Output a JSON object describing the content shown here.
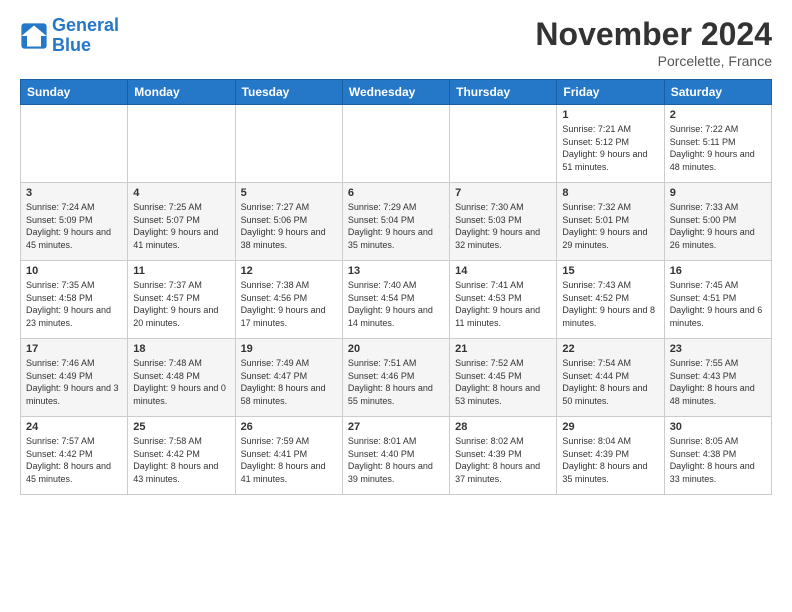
{
  "logo": {
    "line1": "General",
    "line2": "Blue"
  },
  "title": "November 2024",
  "location": "Porcelette, France",
  "days_header": [
    "Sunday",
    "Monday",
    "Tuesday",
    "Wednesday",
    "Thursday",
    "Friday",
    "Saturday"
  ],
  "weeks": [
    [
      {
        "day": "",
        "info": ""
      },
      {
        "day": "",
        "info": ""
      },
      {
        "day": "",
        "info": ""
      },
      {
        "day": "",
        "info": ""
      },
      {
        "day": "",
        "info": ""
      },
      {
        "day": "1",
        "info": "Sunrise: 7:21 AM\nSunset: 5:12 PM\nDaylight: 9 hours and 51 minutes."
      },
      {
        "day": "2",
        "info": "Sunrise: 7:22 AM\nSunset: 5:11 PM\nDaylight: 9 hours and 48 minutes."
      }
    ],
    [
      {
        "day": "3",
        "info": "Sunrise: 7:24 AM\nSunset: 5:09 PM\nDaylight: 9 hours and 45 minutes."
      },
      {
        "day": "4",
        "info": "Sunrise: 7:25 AM\nSunset: 5:07 PM\nDaylight: 9 hours and 41 minutes."
      },
      {
        "day": "5",
        "info": "Sunrise: 7:27 AM\nSunset: 5:06 PM\nDaylight: 9 hours and 38 minutes."
      },
      {
        "day": "6",
        "info": "Sunrise: 7:29 AM\nSunset: 5:04 PM\nDaylight: 9 hours and 35 minutes."
      },
      {
        "day": "7",
        "info": "Sunrise: 7:30 AM\nSunset: 5:03 PM\nDaylight: 9 hours and 32 minutes."
      },
      {
        "day": "8",
        "info": "Sunrise: 7:32 AM\nSunset: 5:01 PM\nDaylight: 9 hours and 29 minutes."
      },
      {
        "day": "9",
        "info": "Sunrise: 7:33 AM\nSunset: 5:00 PM\nDaylight: 9 hours and 26 minutes."
      }
    ],
    [
      {
        "day": "10",
        "info": "Sunrise: 7:35 AM\nSunset: 4:58 PM\nDaylight: 9 hours and 23 minutes."
      },
      {
        "day": "11",
        "info": "Sunrise: 7:37 AM\nSunset: 4:57 PM\nDaylight: 9 hours and 20 minutes."
      },
      {
        "day": "12",
        "info": "Sunrise: 7:38 AM\nSunset: 4:56 PM\nDaylight: 9 hours and 17 minutes."
      },
      {
        "day": "13",
        "info": "Sunrise: 7:40 AM\nSunset: 4:54 PM\nDaylight: 9 hours and 14 minutes."
      },
      {
        "day": "14",
        "info": "Sunrise: 7:41 AM\nSunset: 4:53 PM\nDaylight: 9 hours and 11 minutes."
      },
      {
        "day": "15",
        "info": "Sunrise: 7:43 AM\nSunset: 4:52 PM\nDaylight: 9 hours and 8 minutes."
      },
      {
        "day": "16",
        "info": "Sunrise: 7:45 AM\nSunset: 4:51 PM\nDaylight: 9 hours and 6 minutes."
      }
    ],
    [
      {
        "day": "17",
        "info": "Sunrise: 7:46 AM\nSunset: 4:49 PM\nDaylight: 9 hours and 3 minutes."
      },
      {
        "day": "18",
        "info": "Sunrise: 7:48 AM\nSunset: 4:48 PM\nDaylight: 9 hours and 0 minutes."
      },
      {
        "day": "19",
        "info": "Sunrise: 7:49 AM\nSunset: 4:47 PM\nDaylight: 8 hours and 58 minutes."
      },
      {
        "day": "20",
        "info": "Sunrise: 7:51 AM\nSunset: 4:46 PM\nDaylight: 8 hours and 55 minutes."
      },
      {
        "day": "21",
        "info": "Sunrise: 7:52 AM\nSunset: 4:45 PM\nDaylight: 8 hours and 53 minutes."
      },
      {
        "day": "22",
        "info": "Sunrise: 7:54 AM\nSunset: 4:44 PM\nDaylight: 8 hours and 50 minutes."
      },
      {
        "day": "23",
        "info": "Sunrise: 7:55 AM\nSunset: 4:43 PM\nDaylight: 8 hours and 48 minutes."
      }
    ],
    [
      {
        "day": "24",
        "info": "Sunrise: 7:57 AM\nSunset: 4:42 PM\nDaylight: 8 hours and 45 minutes."
      },
      {
        "day": "25",
        "info": "Sunrise: 7:58 AM\nSunset: 4:42 PM\nDaylight: 8 hours and 43 minutes."
      },
      {
        "day": "26",
        "info": "Sunrise: 7:59 AM\nSunset: 4:41 PM\nDaylight: 8 hours and 41 minutes."
      },
      {
        "day": "27",
        "info": "Sunrise: 8:01 AM\nSunset: 4:40 PM\nDaylight: 8 hours and 39 minutes."
      },
      {
        "day": "28",
        "info": "Sunrise: 8:02 AM\nSunset: 4:39 PM\nDaylight: 8 hours and 37 minutes."
      },
      {
        "day": "29",
        "info": "Sunrise: 8:04 AM\nSunset: 4:39 PM\nDaylight: 8 hours and 35 minutes."
      },
      {
        "day": "30",
        "info": "Sunrise: 8:05 AM\nSunset: 4:38 PM\nDaylight: 8 hours and 33 minutes."
      }
    ]
  ]
}
